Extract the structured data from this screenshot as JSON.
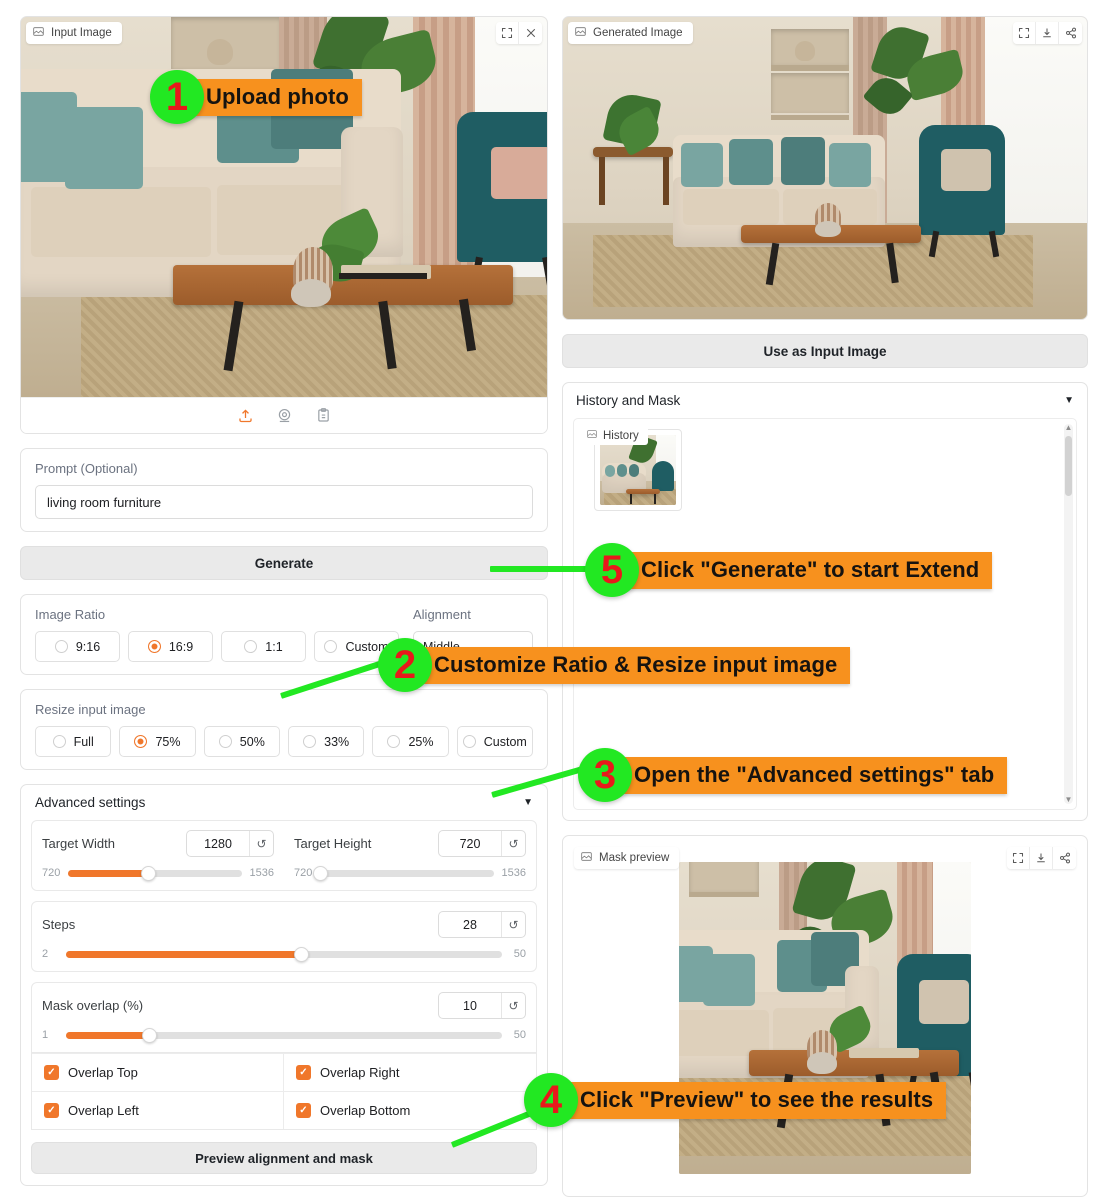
{
  "input_panel": {
    "tag": "Input Image",
    "tools": [
      "expand-icon",
      "close-icon"
    ],
    "footer_icons": [
      "upload-icon",
      "webcam-icon",
      "paste-icon"
    ]
  },
  "prompt": {
    "label": "Prompt (Optional)",
    "value": "living room furniture",
    "placeholder": "Prompt (Optional)"
  },
  "generate_button": "Generate",
  "image_ratio": {
    "label": "Image Ratio",
    "options": [
      "9:16",
      "16:9",
      "1:1",
      "Custom"
    ],
    "selected": "16:9"
  },
  "alignment": {
    "label": "Alignment",
    "value": "Middle"
  },
  "resize": {
    "label": "Resize input image",
    "options": [
      "Full",
      "75%",
      "50%",
      "33%",
      "25%",
      "Custom"
    ],
    "selected": "75%"
  },
  "advanced": {
    "title": "Advanced settings",
    "caret": "▼",
    "target_width": {
      "label": "Target Width",
      "value": "1280",
      "min": "720",
      "max": "1536",
      "fill_pct": 46,
      "reset": "↺"
    },
    "target_height": {
      "label": "Target Height",
      "value": "720",
      "min": "720",
      "max": "1536",
      "fill_pct": 0,
      "reset": "↺"
    },
    "steps": {
      "label": "Steps",
      "value": "28",
      "min": "2",
      "max": "50",
      "fill_pct": 54,
      "reset": "↺"
    },
    "mask_overlap": {
      "label": "Mask overlap (%)",
      "value": "10",
      "min": "1",
      "max": "50",
      "fill_pct": 19,
      "reset": "↺"
    },
    "checkboxes": [
      {
        "label": "Overlap Top",
        "checked": true
      },
      {
        "label": "Overlap Right",
        "checked": true
      },
      {
        "label": "Overlap Left",
        "checked": true
      },
      {
        "label": "Overlap Bottom",
        "checked": true
      }
    ],
    "preview_button": "Preview alignment and mask"
  },
  "generated_panel": {
    "tag": "Generated Image",
    "tools": [
      "expand-icon",
      "download-icon",
      "share-icon"
    ],
    "use_as_input_button": "Use as Input Image"
  },
  "history_and_mask": {
    "title": "History and Mask",
    "caret": "▼",
    "history_tag": "History"
  },
  "mask_preview": {
    "tag": "Mask preview",
    "tools": [
      "expand-icon",
      "download-icon",
      "share-icon"
    ]
  },
  "callouts": [
    {
      "number": "1",
      "text": "Upload photo"
    },
    {
      "number": "2",
      "text": "Customize Ratio & Resize input image"
    },
    {
      "number": "3",
      "text": "Open the \"Advanced settings\" tab"
    },
    {
      "number": "4",
      "text": "Click \"Preview\" to see the results"
    },
    {
      "number": "5",
      "text": "Click \"Generate\" to start Extend"
    }
  ],
  "colors": {
    "accent": "#f0772b",
    "callout_bar": "#f7911e",
    "callout_circle": "#22e822",
    "callout_number": "#e8191b"
  }
}
